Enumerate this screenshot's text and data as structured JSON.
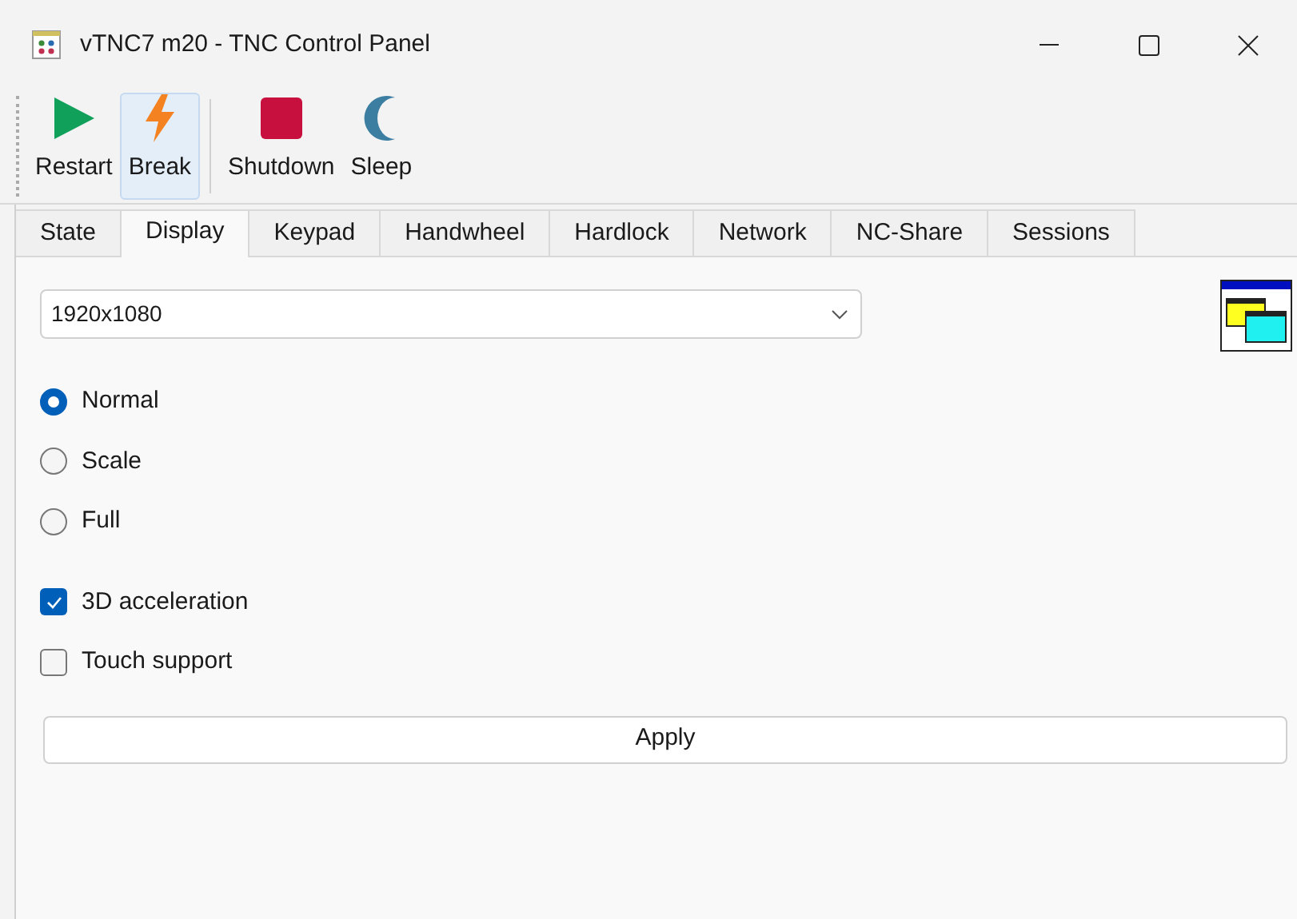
{
  "window": {
    "title": "vTNC7 m20 - TNC Control Panel"
  },
  "toolbar": [
    {
      "kind": "play",
      "label": "Restart",
      "selected": false
    },
    {
      "kind": "bolt",
      "label": "Break",
      "selected": true
    },
    {
      "kind": "stop",
      "label": "Shutdown",
      "selected": false
    },
    {
      "kind": "moon",
      "label": "Sleep",
      "selected": false
    }
  ],
  "tabs": [
    {
      "label": "State",
      "selected": false
    },
    {
      "label": "Display",
      "selected": true
    },
    {
      "label": "Keypad",
      "selected": false
    },
    {
      "label": "Handwheel",
      "selected": false
    },
    {
      "label": "Hardlock",
      "selected": false
    },
    {
      "label": "Network",
      "selected": false
    },
    {
      "label": "NC-Share",
      "selected": false
    },
    {
      "label": "Sessions",
      "selected": false
    }
  ],
  "resolution": {
    "value": "1920x1080"
  },
  "modes": [
    {
      "label": "Normal",
      "selected": true
    },
    {
      "label": "Scale",
      "selected": false
    },
    {
      "label": "Full",
      "selected": false
    }
  ],
  "options": [
    {
      "label": "3D acceleration",
      "checked": true
    },
    {
      "label": "Touch support",
      "checked": false
    }
  ],
  "apply_button": "Apply"
}
